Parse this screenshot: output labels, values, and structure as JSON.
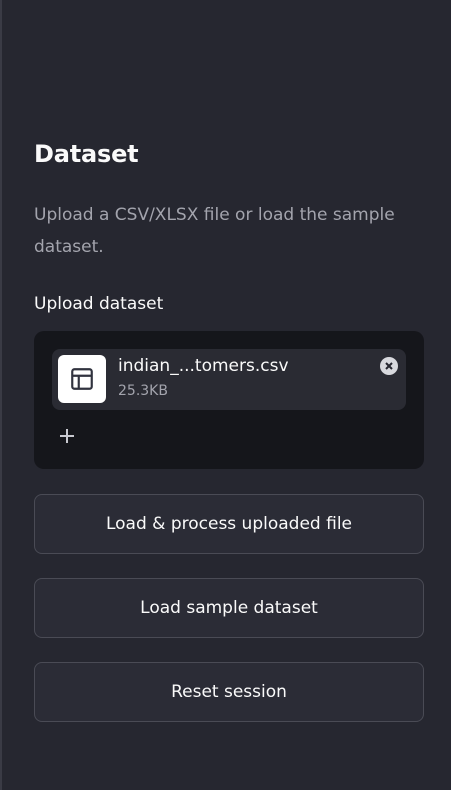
{
  "sidebar": {
    "title": "Dataset",
    "subtitle": "Upload a CSV/XLSX file or load the sample dataset.",
    "upload_label": "Upload dataset",
    "uploaded_file": {
      "name": "indian_...tomers.csv",
      "size": "25.3KB",
      "icon": "table-icon"
    },
    "add_icon": "plus-icon",
    "remove_icon": "close-circle-icon",
    "buttons": [
      {
        "label": "Load & process uploaded file"
      },
      {
        "label": "Load sample dataset"
      },
      {
        "label": "Reset session"
      }
    ]
  },
  "colors": {
    "background": "#262730",
    "dropzone": "#15161b",
    "text": "#fafafa",
    "muted_text": "#a3a4ad"
  }
}
